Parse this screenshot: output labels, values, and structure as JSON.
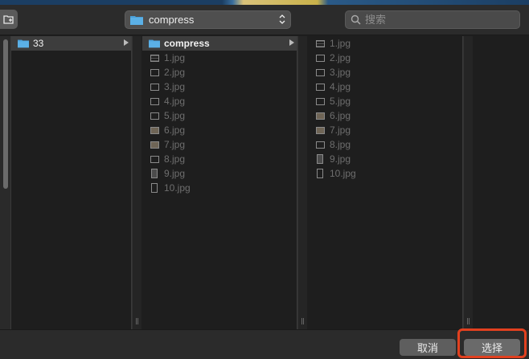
{
  "toolbar": {
    "new_folder_icon": "new-folder-icon",
    "path_popup": {
      "label": "compress",
      "icon": "folder-icon"
    },
    "search": {
      "placeholder": "搜索",
      "icon": "search-icon"
    }
  },
  "columns": [
    {
      "items": [
        {
          "label": "33",
          "type": "folder",
          "selected": true,
          "has_children": true
        }
      ]
    },
    {
      "items": [
        {
          "label": "compress",
          "type": "folder",
          "selected": true,
          "has_children": true
        },
        {
          "label": "1.jpg",
          "thumb": "lines"
        },
        {
          "label": "2.jpg",
          "thumb": "plain"
        },
        {
          "label": "3.jpg",
          "thumb": "plain"
        },
        {
          "label": "4.jpg",
          "thumb": "plain"
        },
        {
          "label": "5.jpg",
          "thumb": "plain"
        },
        {
          "label": "6.jpg",
          "thumb": "filled"
        },
        {
          "label": "7.jpg",
          "thumb": "filled"
        },
        {
          "label": "8.jpg",
          "thumb": "plain"
        },
        {
          "label": "9.jpg",
          "thumb": "tall-pic"
        },
        {
          "label": "10.jpg",
          "thumb": "tall"
        }
      ]
    },
    {
      "items": [
        {
          "label": "1.jpg",
          "thumb": "lines"
        },
        {
          "label": "2.jpg",
          "thumb": "plain"
        },
        {
          "label": "3.jpg",
          "thumb": "plain"
        },
        {
          "label": "4.jpg",
          "thumb": "plain"
        },
        {
          "label": "5.jpg",
          "thumb": "plain"
        },
        {
          "label": "6.jpg",
          "thumb": "filled"
        },
        {
          "label": "7.jpg",
          "thumb": "filled"
        },
        {
          "label": "8.jpg",
          "thumb": "plain"
        },
        {
          "label": "9.jpg",
          "thumb": "tall-pic"
        },
        {
          "label": "10.jpg",
          "thumb": "tall"
        }
      ]
    }
  ],
  "buttons": {
    "cancel_label": "取消",
    "choose_label": "选择"
  },
  "colors": {
    "highlight": "#e2401f",
    "folder": "#4a9fd8",
    "selection": "#3d3d3d"
  }
}
